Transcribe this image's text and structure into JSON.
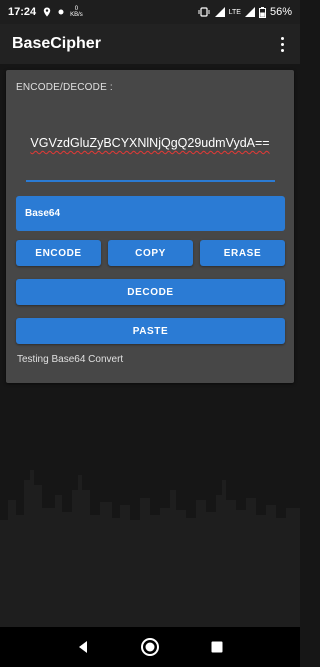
{
  "status_bar": {
    "time": "17:24",
    "data_rate_value": "0",
    "data_rate_unit": "KB/s",
    "network_label": "LTE",
    "battery": "56%"
  },
  "app_bar": {
    "title": "BaseCipher",
    "overflow_icon": "more-vert-icon"
  },
  "card": {
    "label": "ENCODE/DECODE :",
    "input_value": "VGVzdGluZyBCYXNlNjQgQ29udmVydA==",
    "selected_encoding": "Base64",
    "buttons": {
      "encode": "ENCODE",
      "copy": "COPY",
      "erase": "ERASE",
      "decode": "DECODE",
      "paste": "PASTE"
    },
    "output_text": "Testing Base64 Convert"
  },
  "colors": {
    "accent": "#2b7bd4",
    "card_background": "#474747",
    "app_bar": "#222222",
    "background": "#161616"
  }
}
